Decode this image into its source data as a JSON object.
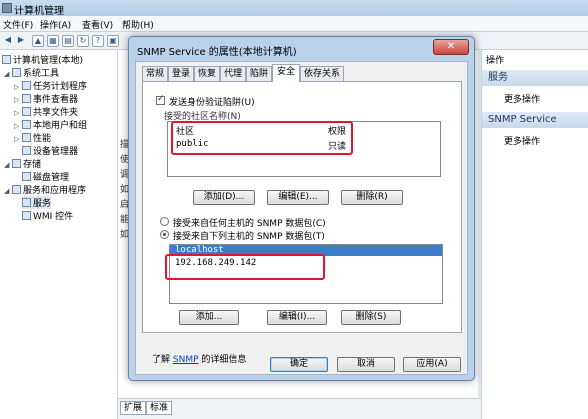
{
  "window": {
    "title": "计算机管理",
    "menu": [
      "文件(F)",
      "操作(A)",
      "查看(V)",
      "帮助(H)"
    ]
  },
  "tree": {
    "root": "计算机管理(本地)",
    "items": [
      {
        "label": "系统工具",
        "indent": 1
      },
      {
        "label": "任务计划程序",
        "indent": 2
      },
      {
        "label": "事件查看器",
        "indent": 2
      },
      {
        "label": "共享文件夹",
        "indent": 2
      },
      {
        "label": "本地用户和组",
        "indent": 2
      },
      {
        "label": "性能",
        "indent": 2
      },
      {
        "label": "设备管理器",
        "indent": 2
      },
      {
        "label": "存储",
        "indent": 1
      },
      {
        "label": "磁盘管理",
        "indent": 2
      },
      {
        "label": "服务和应用程序",
        "indent": 1
      },
      {
        "label": "服务",
        "indent": 2
      },
      {
        "label": "WMI 控件",
        "indent": 2
      }
    ]
  },
  "center": {
    "partial_text": "描使调如启能如"
  },
  "right_panel": {
    "header": "操作",
    "sections": [
      {
        "title": "服务",
        "item": "更多操作"
      },
      {
        "title": "SNMP Service",
        "item": "更多操作"
      }
    ]
  },
  "bottom_tabs": [
    "扩展",
    "标准"
  ],
  "dialog": {
    "title": "SNMP Service 的属性(本地计算机)",
    "close": "✕",
    "tabs": [
      "常规",
      "登录",
      "恢复",
      "代理",
      "陷阱",
      "安全",
      "依存关系"
    ],
    "active_tab": "安全",
    "send_auth_trap": "发送身份验证陷阱(U)",
    "community_label": "接受的社区名称(N)",
    "community_headers": [
      "社区",
      "权限"
    ],
    "community_rows": [
      {
        "name": "public",
        "rights": "只读"
      }
    ],
    "buttons1": [
      "添加(D)...",
      "编辑(E)...",
      "删除(R)"
    ],
    "radio_any": "接受来自任何主机的 SNMP 数据包(C)",
    "radio_these": "接受来自下列主机的 SNMP 数据包(T)",
    "hosts": [
      "localhost",
      "192.168.249.142"
    ],
    "buttons2": [
      "添加...",
      "编辑(I)...",
      "删除(S)"
    ],
    "learn_prefix": "了解",
    "learn_link": "SNMP",
    "learn_suffix": "的详细信息",
    "footer_buttons": [
      "确定",
      "取消",
      "应用(A)"
    ]
  }
}
